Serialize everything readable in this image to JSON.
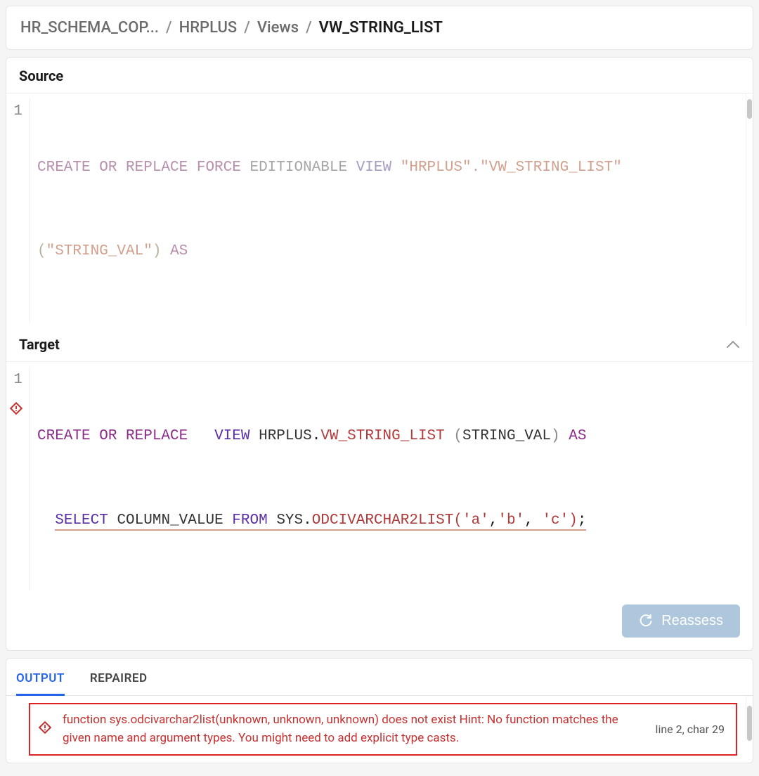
{
  "breadcrumb": [
    "HR_SCHEMA_COP...",
    "HRPLUS",
    "Views",
    "VW_STRING_LIST"
  ],
  "source": {
    "title": "Source",
    "lines": [
      {
        "num": "1",
        "html": "<span class='kw'>CREATE OR REPLACE FORCE</span> <span class='kw2'>EDITIONABLE</span> <span class='type'>VIEW</span> <span class='str'>\"HRPLUS\"</span>.<span class='str'>\"VW_STRING_LIST\"</span>"
      },
      {
        "num": "",
        "html": "<span class='par'>(</span><span class='str'>\"STRING_VAL\"</span><span class='par'>)</span> <span class='kw'>AS</span>"
      }
    ]
  },
  "target": {
    "title": "Target",
    "lines": [
      {
        "num": "1",
        "err": false,
        "html": "<span class='kw'>CREATE OR REPLACE</span>   <span class='kw2'>VIEW</span> <span class='id'>HRPLUS</span>.<span class='fn'>VW_STRING_LIST</span> <span class='par'>(</span><span class='id'>STRING_VAL</span><span class='par'>)</span> <span class='kw'>AS</span>"
      },
      {
        "num": "",
        "err": true,
        "html": "  <span class='underline-err'><span class='kw2'>SELECT</span> <span class='id'>COLUMN_VALUE</span> <span class='kw2'>FROM</span> <span class='id'>SYS</span>.<span class='fn'>ODCIVARCHAR2LIST(</span><span class='lit'>'a'</span>,<span class='lit'>'b'</span>, <span class='lit'>'c'</span><span class='fn'>)</span>;</span>"
      }
    ]
  },
  "reassess_label": "Reassess",
  "tabs": [
    {
      "id": "output",
      "label": "OUTPUT",
      "active": true
    },
    {
      "id": "repaired",
      "label": "REPAIRED",
      "active": false
    }
  ],
  "error": {
    "message": "function sys.odcivarchar2list(unknown, unknown, unknown) does not exist Hint: No function matches the given name and argument types. You might need to add explicit type casts.",
    "location": "line 2, char 29"
  }
}
